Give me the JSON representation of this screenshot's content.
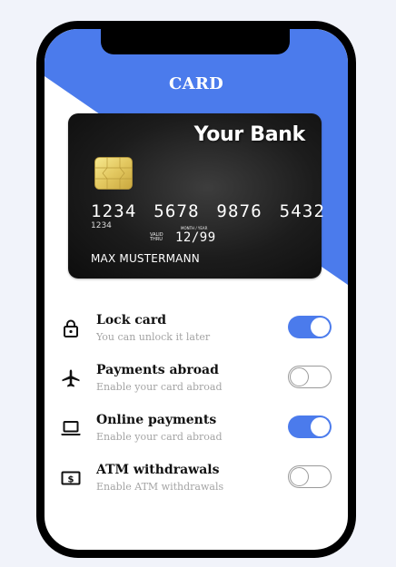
{
  "header": {
    "title": "CARD"
  },
  "card": {
    "bank_name": "Your Bank",
    "number": "1234 5678 9876 5432",
    "number_sub": "1234",
    "valid_thru": "VALID THRU",
    "month_year": "MONTH / YEAR",
    "expiry": "12/99",
    "holder": "MAX MUSTERMANN"
  },
  "settings": [
    {
      "title": "Lock card",
      "description": "You can unlock it later",
      "icon": "lock-icon",
      "enabled": true
    },
    {
      "title": "Payments abroad",
      "description": "Enable your card abroad",
      "icon": "airplane-icon",
      "enabled": false
    },
    {
      "title": "Online payments",
      "description": "Enable your card abroad",
      "icon": "laptop-icon",
      "enabled": true
    },
    {
      "title": "ATM withdrawals",
      "description": "Enable ATM withdrawals",
      "icon": "cash-icon",
      "enabled": false
    }
  ],
  "colors": {
    "accent": "#4b7bec",
    "phone_frame": "#000000",
    "card_dark": "#1c1c1c"
  }
}
